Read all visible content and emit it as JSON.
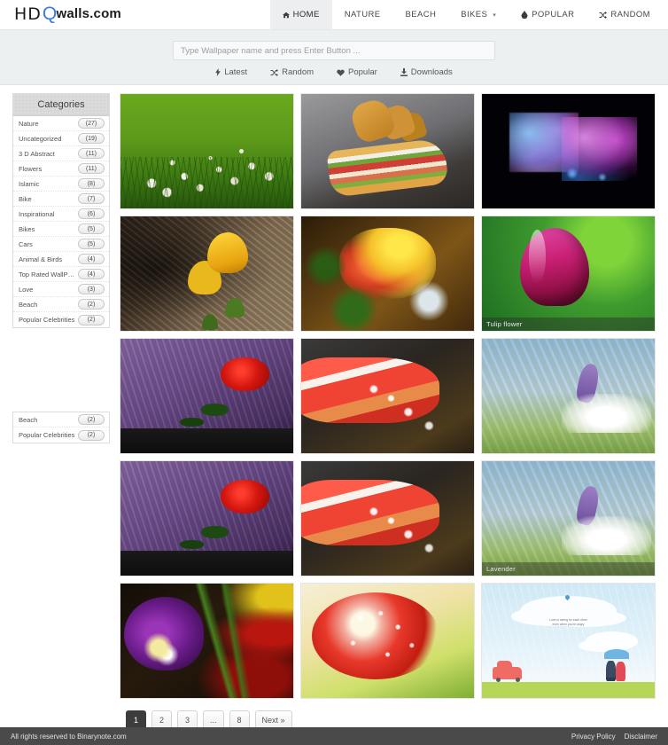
{
  "brand": {
    "part1": "HD",
    "part2": "Q",
    "part3": "walls.com"
  },
  "nav": {
    "items": [
      {
        "label": "HOME",
        "icon": "home-icon",
        "active": true
      },
      {
        "label": "NATURE",
        "icon": "",
        "active": false
      },
      {
        "label": "BEACH",
        "icon": "",
        "active": false
      },
      {
        "label": "BIKES",
        "icon": "",
        "caret": true,
        "active": false
      },
      {
        "label": "POPULAR",
        "icon": "droplet-icon",
        "active": false
      },
      {
        "label": "RANDOM",
        "icon": "shuffle-icon",
        "active": false
      }
    ]
  },
  "search": {
    "placeholder": "Type Wallpaper name and press Enter Button ...",
    "value": ""
  },
  "filters": [
    {
      "label": "Latest",
      "icon": "bolt-icon"
    },
    {
      "label": "Random",
      "icon": "shuffle-icon"
    },
    {
      "label": "Popular",
      "icon": "heart-icon"
    },
    {
      "label": "Downloads",
      "icon": "download-icon"
    }
  ],
  "sidebar": {
    "panel_title": "Categories",
    "categories": [
      {
        "label": "Nature",
        "count": "(27)"
      },
      {
        "label": "Uncategorized",
        "count": "(19)"
      },
      {
        "label": "3 D Abstract",
        "count": "(11)"
      },
      {
        "label": "Flowers",
        "count": "(11)"
      },
      {
        "label": "Islamic",
        "count": "(8)"
      },
      {
        "label": "Bike",
        "count": "(7)"
      },
      {
        "label": "Inspirational",
        "count": "(6)"
      },
      {
        "label": "Bikes",
        "count": "(5)"
      },
      {
        "label": "Cars",
        "count": "(5)"
      },
      {
        "label": "Animal & Birds",
        "count": "(4)"
      },
      {
        "label": "Top Rated WallPaper",
        "count": "(4)"
      },
      {
        "label": "Love",
        "count": "(3)"
      },
      {
        "label": "Beach",
        "count": "(2)"
      },
      {
        "label": "Popular Celebrities",
        "count": "(2)"
      }
    ],
    "categories_overflow": [
      {
        "label": "Beach",
        "count": "(2)"
      },
      {
        "label": "Popular Celebrities",
        "count": "(2)"
      }
    ]
  },
  "gallery": {
    "tiles": [
      {
        "art": "art-flowers-green",
        "caption": ""
      },
      {
        "art": "art-sandwich",
        "caption": ""
      },
      {
        "art": "art-butterfly",
        "caption": ""
      },
      {
        "art": "art-yellow-tulip",
        "caption": ""
      },
      {
        "art": "art-rose-yellow",
        "caption": ""
      },
      {
        "art": "art-pink-tulip",
        "caption": "Tulip flower"
      },
      {
        "art": "art-red-rose-purple",
        "caption": ""
      },
      {
        "art": "art-red-dew",
        "caption": ""
      },
      {
        "art": "art-lavender",
        "caption": ""
      },
      {
        "art": "art-red-rose-purple",
        "caption": ""
      },
      {
        "art": "art-red-dew",
        "caption": ""
      },
      {
        "art": "art-lavender",
        "caption": "Lavender"
      },
      {
        "art": "art-purple-tulip",
        "caption": ""
      },
      {
        "art": "art-red-gerbera",
        "caption": ""
      },
      {
        "art": "art-love-cartoon",
        "caption": ""
      }
    ],
    "cartoon_text_line1": "Love is caring for each other",
    "cartoon_text_line2": "even when you're angry"
  },
  "pagination": [
    {
      "label": "1",
      "active": true
    },
    {
      "label": "2",
      "active": false
    },
    {
      "label": "3",
      "active": false
    },
    {
      "label": "...",
      "active": false
    },
    {
      "label": "8",
      "active": false
    },
    {
      "label": "Next »",
      "active": false
    }
  ],
  "footer": {
    "copyright": "All rights reserved to Binarynote.com",
    "links": [
      "Privacy Policy",
      "Disclaimer"
    ]
  }
}
